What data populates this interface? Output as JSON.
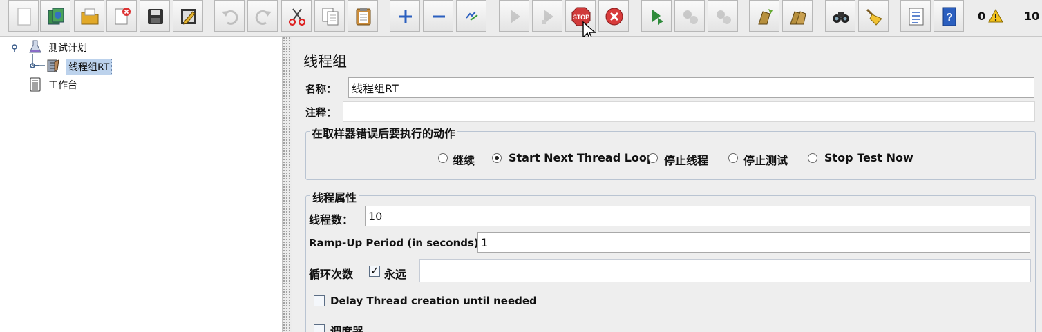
{
  "toolbar": {
    "buttons": [
      {
        "name": "new-icon",
        "enabled": true
      },
      {
        "name": "templates-icon",
        "enabled": true
      },
      {
        "name": "open-icon",
        "enabled": true
      },
      {
        "name": "close-icon",
        "enabled": true
      },
      {
        "name": "save-icon",
        "enabled": true
      },
      {
        "name": "save-as-icon",
        "enabled": true
      },
      {
        "name": "undo-icon",
        "enabled": false
      },
      {
        "name": "redo-icon",
        "enabled": false
      },
      {
        "name": "cut-icon",
        "enabled": true
      },
      {
        "name": "copy-icon",
        "enabled": true
      },
      {
        "name": "paste-icon",
        "enabled": true
      },
      {
        "name": "expand-icon",
        "enabled": true
      },
      {
        "name": "collapse-icon",
        "enabled": true
      },
      {
        "name": "toggle-icon",
        "enabled": true
      },
      {
        "name": "start-icon",
        "enabled": false
      },
      {
        "name": "start-no-pause-icon",
        "enabled": false
      },
      {
        "name": "stop-icon",
        "enabled": true,
        "text": "STOP"
      },
      {
        "name": "shutdown-icon",
        "enabled": true
      },
      {
        "name": "remote-start-icon",
        "enabled": true
      },
      {
        "name": "remote-stop-icon",
        "enabled": false
      },
      {
        "name": "remote-shutdown-icon",
        "enabled": false
      },
      {
        "name": "clear-icon",
        "enabled": true
      },
      {
        "name": "clear-all-icon",
        "enabled": true
      },
      {
        "name": "search-icon",
        "enabled": true
      },
      {
        "name": "reset-search-icon",
        "enabled": true
      },
      {
        "name": "function-helper-icon",
        "enabled": true
      },
      {
        "name": "help-icon",
        "enabled": true,
        "text": "?"
      }
    ],
    "error_count": "0",
    "thread_count": "10"
  },
  "tree": {
    "items": [
      {
        "label": "测试计划",
        "icon": "test-plan-flask-icon"
      },
      {
        "label": "线程组RT",
        "icon": "thread-group-icon",
        "selected": true
      },
      {
        "label": "工作台",
        "icon": "workbench-clipboard-icon"
      }
    ]
  },
  "panel": {
    "title": "线程组",
    "name_label": "名称：",
    "name_value": "线程组RT",
    "comment_label": "注释：",
    "comment_value": "",
    "error_action": {
      "title": "在取样器错误后要执行的动作",
      "options": [
        "继续",
        "Start Next Thread Loop",
        "停止线程",
        "停止测试",
        "Stop Test Now"
      ],
      "selected": "Start Next Thread Loop"
    },
    "thread_props": {
      "title": "线程属性",
      "threads_label": "线程数：",
      "threads_value": "10",
      "ramp_label": "Ramp-Up Period (in seconds):",
      "ramp_value": "1",
      "loop_label": "循环次数",
      "forever_label": "永远",
      "forever_checked": true,
      "loop_value": "",
      "delay_label": "Delay Thread creation until needed",
      "delay_checked": false,
      "scheduler_label": "调度器",
      "scheduler_checked": false
    }
  },
  "colors": {
    "selected_bg": "#bcd2ec",
    "stop_red": "#d03a3a",
    "accent_blue": "#2b5fbf"
  }
}
